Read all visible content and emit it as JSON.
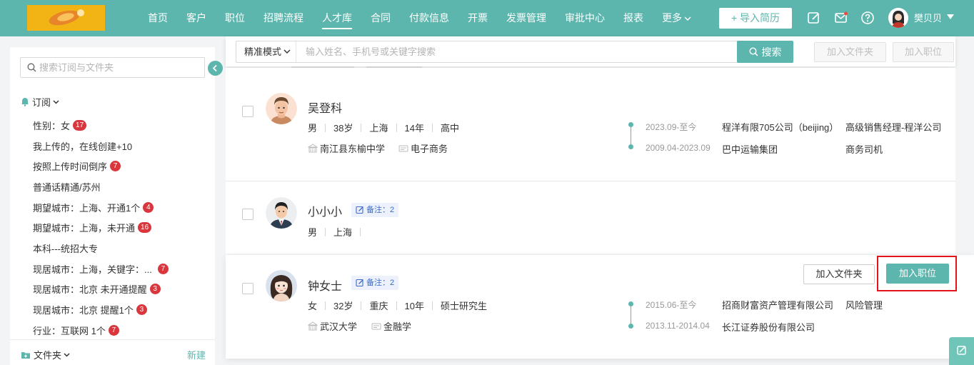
{
  "nav": {
    "items": [
      "首页",
      "客户",
      "职位",
      "招聘流程",
      "人才库",
      "合同",
      "付款信息",
      "开票",
      "发票管理",
      "审批中心",
      "报表",
      "更多"
    ],
    "active_index": 4,
    "import_button": "+ 导入简历",
    "user_name": "樊贝贝"
  },
  "sidebar": {
    "search_placeholder": "搜索订阅与文件夹",
    "subscription_label": "订阅",
    "items": [
      {
        "label": "性别：女",
        "badge": "17"
      },
      {
        "label": "我上传的，在线创建+10",
        "badge": ""
      },
      {
        "label": "按照上传时间倒序",
        "badge": "7"
      },
      {
        "label": "普通话精通/苏州",
        "badge": ""
      },
      {
        "label": "期望城市：上海、开通1个",
        "badge": "4"
      },
      {
        "label": "期望城市：上海，未开通",
        "badge": "16"
      },
      {
        "label": "本科---统招大专",
        "badge": ""
      },
      {
        "label": "现居城市：上海，关键字：...",
        "badge": "7"
      },
      {
        "label": "现居城市：北京 未开通提醒",
        "badge": "3"
      },
      {
        "label": "现居城市：北京 提醒1个",
        "badge": "3"
      },
      {
        "label": "行业：互联网 1个",
        "badge": "7"
      }
    ],
    "folder_label": "文件夹",
    "new_label": "新建"
  },
  "search": {
    "mode": "精准模式",
    "placeholder": "输入姓名、手机号或关键字搜索",
    "search_button": "搜索",
    "add_folder_button": "加入文件夹",
    "add_position_button": "加入职位"
  },
  "candidates": [
    {
      "name": "吴登科",
      "note": "",
      "attrs": [
        "男",
        "38岁",
        "上海",
        "14年",
        "高中"
      ],
      "school": "南江县东榆中学",
      "major": "电子商务",
      "experiences": [
        {
          "date": "2023.09-至今",
          "company": "程洋有限705公司（beijing）",
          "title": "高级销售经理-程洋公司"
        },
        {
          "date": "2009.04-2023.09",
          "company": "巴中运输集团",
          "title": "商务司机"
        }
      ]
    },
    {
      "name": "小小小",
      "note": "备注：2",
      "attrs": [
        "男",
        "上海"
      ],
      "school": "",
      "major": "",
      "experiences": []
    },
    {
      "name": "钟女士",
      "note": "备注：2",
      "attrs": [
        "女",
        "32岁",
        "重庆",
        "10年",
        "硕士研究生"
      ],
      "school": "武汉大学",
      "major": "金融学",
      "experiences": [
        {
          "date": "2015.06-至今",
          "company": "招商财富资产管理有限公司",
          "title": "风险管理"
        },
        {
          "date": "2013.11-2014.04",
          "company": "长江证券股份有限公司",
          "title": ""
        }
      ],
      "add_folder_button": "加入文件夹",
      "add_position_button": "加入职位"
    }
  ],
  "colors": {
    "primary": "#5cb6ad",
    "badge": "#d9363e",
    "highlight": "#e3151b"
  }
}
